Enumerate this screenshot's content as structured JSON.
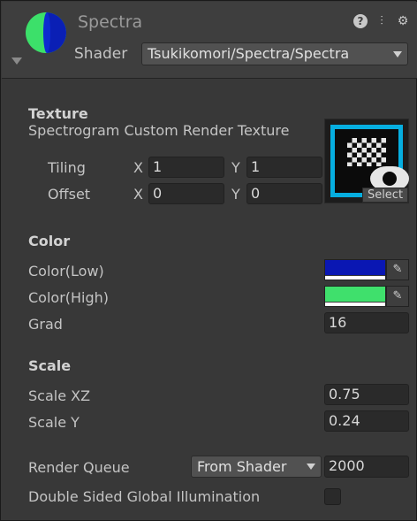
{
  "header": {
    "material_name": "Spectra",
    "shader_label": "Shader",
    "shader_value": "Tsukikomori/Spectra/Spectra",
    "icons": [
      "help-icon",
      "preset-sliders-icon",
      "gear-icon"
    ]
  },
  "texture": {
    "section": "Texture",
    "name": "Spectrogram Custom Render Texture",
    "tiling_label": "Tiling",
    "offset_label": "Offset",
    "x_label": "X",
    "y_label": "Y",
    "tiling_x": "1",
    "tiling_y": "1",
    "offset_x": "0",
    "offset_y": "0",
    "select_label": "Select"
  },
  "color": {
    "section": "Color",
    "low_label": "Color(Low)",
    "low_color": "#0a17b3",
    "high_label": "Color(High)",
    "high_color": "#3fe06c",
    "grad_label": "Grad",
    "grad_value": "16"
  },
  "scale": {
    "section": "Scale",
    "xz_label": "Scale XZ",
    "xz_value": "0.75",
    "y_label": "Scale Y",
    "y_value": "0.24"
  },
  "render": {
    "queue_label": "Render Queue",
    "queue_mode": "From Shader",
    "queue_value": "2000",
    "dsgi_label": "Double Sided Global Illumination",
    "dsgi_checked": false
  }
}
